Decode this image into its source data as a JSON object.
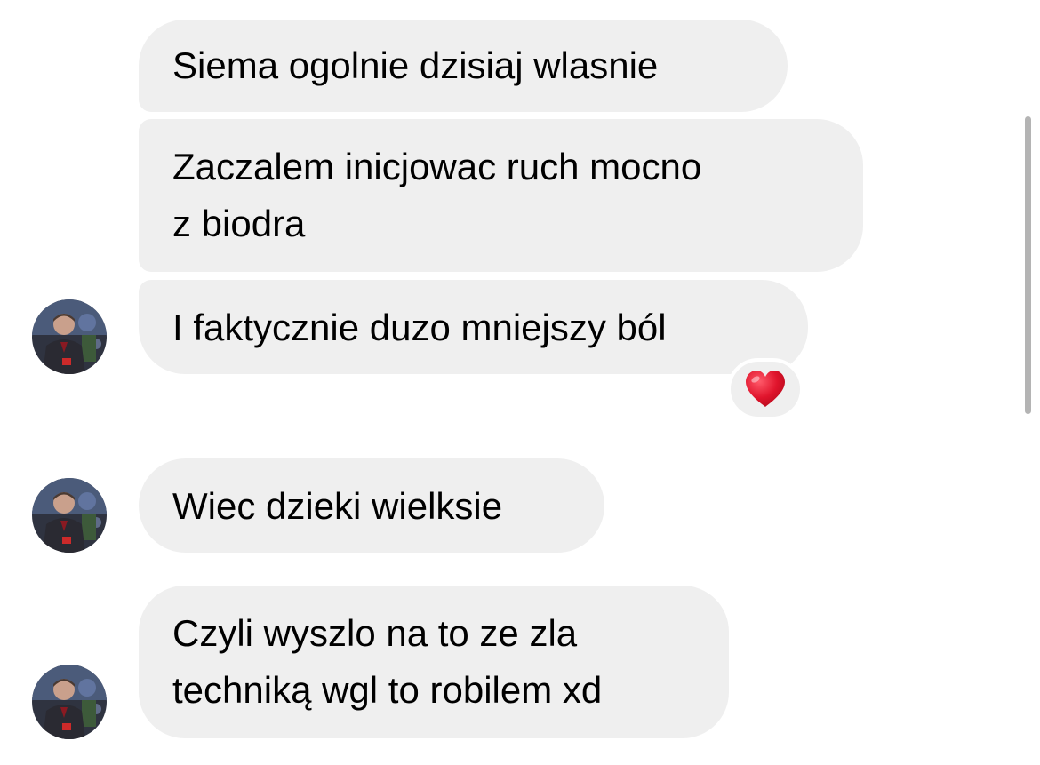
{
  "messages": [
    {
      "lines": [
        "Siema ogolnie dzisiaj wlasnie"
      ]
    },
    {
      "lines": [
        "Zaczalem inicjowac ruch mocno",
        "z biodra"
      ]
    },
    {
      "lines": [
        "I faktycznie duzo mniejszy ból"
      ],
      "reaction": "heart-icon"
    },
    {
      "lines": [
        "Wiec dzieki wielksie"
      ]
    },
    {
      "lines": [
        "Czyli wyszlo na to ze zla",
        "techniką wgl to robilem xd"
      ]
    }
  ],
  "colors": {
    "bubble_background": "#efefef",
    "text": "#000000",
    "reaction_heart": "#e0142c",
    "scrollbar": "#b4b4b4"
  }
}
